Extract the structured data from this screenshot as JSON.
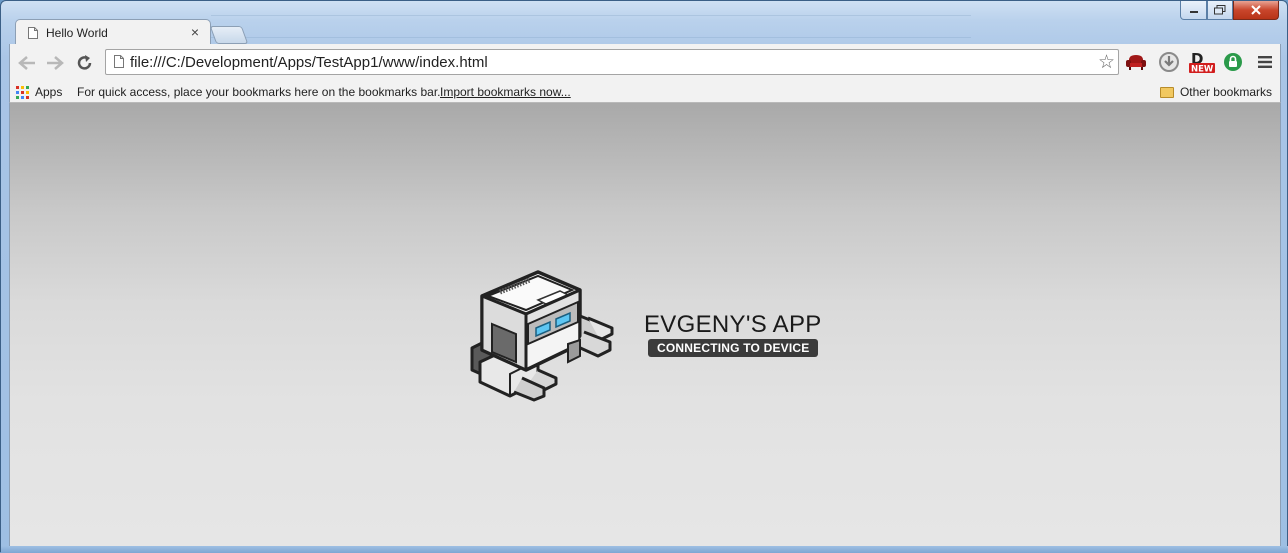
{
  "tab": {
    "title": "Hello World",
    "close_label": "×"
  },
  "omnibox": {
    "url": "file:///C:/Development/Apps/TestApp1/www/index.html"
  },
  "bookmarks": {
    "apps_label": "Apps",
    "hint": "For quick access, place your bookmarks here on the bookmarks bar.",
    "import_link": "Import bookmarks now...",
    "other_label": "Other bookmarks"
  },
  "extensions": [
    {
      "name": "armchair-extension-icon",
      "color": "#a01818"
    },
    {
      "name": "download-extension-icon",
      "color": "#8a8a8a"
    },
    {
      "name": "d-new-extension-icon",
      "label_new": "NEW",
      "label_d": "D"
    },
    {
      "name": "shield-lock-extension-icon",
      "color": "#2a9a4a"
    }
  ],
  "app": {
    "title": "EVGENY'S APP",
    "status": "CONNECTING TO DEVICE"
  },
  "colors": {
    "badge_bg": "#3b3b3b",
    "content_top": "#a9a9a9",
    "content_bottom": "#e6e6e6"
  }
}
